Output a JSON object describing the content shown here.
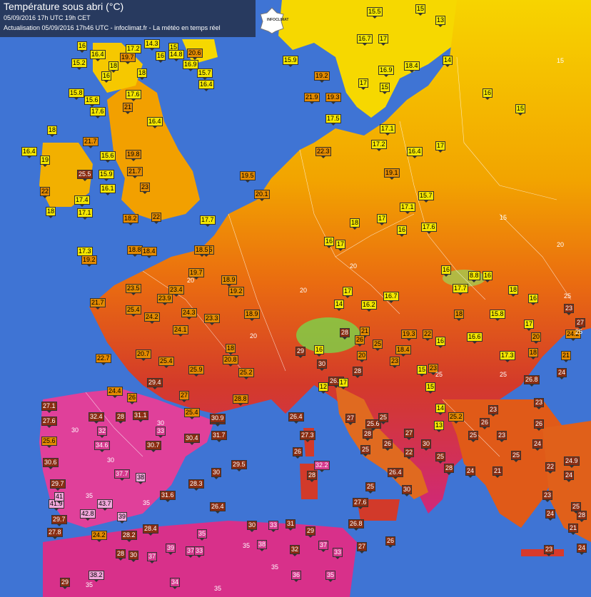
{
  "header": {
    "title": "Température sous abri (°C)",
    "line2": "05/09/2016  17h UTC  19h CET",
    "line3": "Actualisation 05/09/2016 17h46 UTC - infoclimat.fr - La météo en temps réel"
  },
  "logo_text": "INFOCLIMAT",
  "colors": {
    "sea": "#3f74d4",
    "yellow": "#f4e600",
    "orange": "#e38a00",
    "red": "#8a2d12",
    "pink": "#d63a8e",
    "lightpink": "#f2a8dc"
  },
  "stations": [
    {
      "v": "16",
      "c": "y"
    },
    {
      "v": "17.2",
      "c": "y"
    },
    {
      "v": "14.3",
      "c": "y"
    },
    {
      "v": "15",
      "c": "y"
    },
    {
      "v": "16",
      "c": "y"
    },
    {
      "v": "14.8",
      "c": "y"
    },
    {
      "v": "20.6",
      "c": "o"
    },
    {
      "v": "16.4",
      "c": "y"
    },
    {
      "v": "19.7",
      "c": "o"
    },
    {
      "v": "15.2",
      "c": "y"
    },
    {
      "v": "18",
      "c": "y"
    },
    {
      "v": "16.9",
      "c": "y"
    },
    {
      "v": "15.7",
      "c": "y"
    },
    {
      "v": "16",
      "c": "y"
    },
    {
      "v": "18",
      "c": "y"
    },
    {
      "v": "16.4",
      "c": "y"
    },
    {
      "v": "15.8",
      "c": "y"
    },
    {
      "v": "17.6",
      "c": "y"
    },
    {
      "v": "15.6",
      "c": "y"
    },
    {
      "v": "17.6",
      "c": "y"
    },
    {
      "v": "21",
      "c": "o"
    },
    {
      "v": "16.4",
      "c": "y"
    },
    {
      "v": "18",
      "c": "y"
    },
    {
      "v": "21.7",
      "c": "o"
    },
    {
      "v": "16.4",
      "c": "y"
    },
    {
      "v": "19",
      "c": "y"
    },
    {
      "v": "15.6",
      "c": "y"
    },
    {
      "v": "19.8",
      "c": "o"
    },
    {
      "v": "25.5",
      "c": "r"
    },
    {
      "v": "15.9",
      "c": "y"
    },
    {
      "v": "21.7",
      "c": "o"
    },
    {
      "v": "22",
      "c": "o"
    },
    {
      "v": "16.1",
      "c": "y"
    },
    {
      "v": "23",
      "c": "o"
    },
    {
      "v": "17.4",
      "c": "y"
    },
    {
      "v": "18",
      "c": "y"
    },
    {
      "v": "17.1",
      "c": "y"
    },
    {
      "v": "18.2",
      "c": "o"
    },
    {
      "v": "22",
      "c": "o"
    },
    {
      "v": "17.7",
      "c": "y"
    },
    {
      "v": "18.5",
      "c": "o"
    },
    {
      "v": "17.3",
      "c": "y"
    },
    {
      "v": "18.8",
      "c": "o"
    },
    {
      "v": "19.2",
      "c": "o"
    },
    {
      "v": "18.4",
      "c": "o"
    },
    {
      "v": "15.5",
      "c": "y"
    },
    {
      "v": "15",
      "c": "y"
    },
    {
      "v": "13",
      "c": "y"
    },
    {
      "v": "16.7",
      "c": "y"
    },
    {
      "v": "17",
      "c": "y"
    },
    {
      "v": "14",
      "c": "y"
    },
    {
      "v": "15.9",
      "c": "y"
    },
    {
      "v": "18.4",
      "c": "y"
    },
    {
      "v": "16.9",
      "c": "y"
    },
    {
      "v": "17",
      "c": "y"
    },
    {
      "v": "15",
      "c": "y"
    },
    {
      "v": "16",
      "c": "y"
    },
    {
      "v": "15",
      "c": "y"
    },
    {
      "v": "19.2",
      "c": "o"
    },
    {
      "v": "21.9",
      "c": "o"
    },
    {
      "v": "19.3",
      "c": "o"
    },
    {
      "v": "17.5",
      "c": "y"
    },
    {
      "v": "17.1",
      "c": "y"
    },
    {
      "v": "17.2",
      "c": "y"
    },
    {
      "v": "19.1",
      "c": "o"
    },
    {
      "v": "16.4",
      "c": "y"
    },
    {
      "v": "17",
      "c": "y"
    },
    {
      "v": "17.1",
      "c": "y"
    },
    {
      "v": "15.7",
      "c": "y"
    },
    {
      "v": "17.6",
      "c": "y"
    },
    {
      "v": "19.5",
      "c": "o"
    },
    {
      "v": "20.1",
      "c": "o"
    },
    {
      "v": "22.3",
      "c": "o"
    },
    {
      "v": "18.5",
      "c": "o"
    },
    {
      "v": "18.9",
      "c": "o"
    },
    {
      "v": "19.2",
      "c": "o"
    },
    {
      "v": "18.9",
      "c": "o"
    },
    {
      "v": "18",
      "c": "o"
    },
    {
      "v": "19.7",
      "c": "o"
    },
    {
      "v": "21.7",
      "c": "o"
    },
    {
      "v": "23.5",
      "c": "o"
    },
    {
      "v": "25.4",
      "c": "o"
    },
    {
      "v": "23.9",
      "c": "o"
    },
    {
      "v": "23.4",
      "c": "o"
    },
    {
      "v": "24.3",
      "c": "o"
    },
    {
      "v": "24.2",
      "c": "o"
    },
    {
      "v": "23.3",
      "c": "o"
    },
    {
      "v": "24.1",
      "c": "o"
    },
    {
      "v": "22.7",
      "c": "o"
    },
    {
      "v": "20.7",
      "c": "o"
    },
    {
      "v": "25.4",
      "c": "o"
    },
    {
      "v": "29.4",
      "c": "r"
    },
    {
      "v": "25.9",
      "c": "o"
    },
    {
      "v": "20.8",
      "c": "o"
    },
    {
      "v": "25.2",
      "c": "o"
    },
    {
      "v": "24.4",
      "c": "o"
    },
    {
      "v": "26",
      "c": "o"
    },
    {
      "v": "27",
      "c": "o"
    },
    {
      "v": "30.9",
      "c": "r"
    },
    {
      "v": "28.8",
      "c": "o"
    },
    {
      "v": "27.1",
      "c": "r"
    },
    {
      "v": "27.6",
      "c": "r"
    },
    {
      "v": "32.4",
      "c": "r"
    },
    {
      "v": "28",
      "c": "r"
    },
    {
      "v": "31.1",
      "c": "r"
    },
    {
      "v": "25.4",
      "c": "o"
    },
    {
      "v": "30.9",
      "c": "r"
    },
    {
      "v": "25.6",
      "c": "o"
    },
    {
      "v": "34.6",
      "c": "p"
    },
    {
      "v": "32",
      "c": "p"
    },
    {
      "v": "33",
      "c": "p"
    },
    {
      "v": "30.4",
      "c": "r"
    },
    {
      "v": "31.7",
      "c": "r"
    },
    {
      "v": "30.6",
      "c": "r"
    },
    {
      "v": "30.7",
      "c": "r"
    },
    {
      "v": "29.7",
      "c": "r"
    },
    {
      "v": "37.7",
      "c": "p"
    },
    {
      "v": "38",
      "c": "l"
    },
    {
      "v": "41.9",
      "c": "l"
    },
    {
      "v": "41",
      "c": "l"
    },
    {
      "v": "31.6",
      "c": "r"
    },
    {
      "v": "28.3",
      "c": "r"
    },
    {
      "v": "30",
      "c": "r"
    },
    {
      "v": "29.5",
      "c": "r"
    },
    {
      "v": "42.8",
      "c": "l"
    },
    {
      "v": "43.7",
      "c": "l"
    },
    {
      "v": "39",
      "c": "l"
    },
    {
      "v": "26.4",
      "c": "r"
    },
    {
      "v": "29.7",
      "c": "r"
    },
    {
      "v": "27.8",
      "c": "r"
    },
    {
      "v": "24.2",
      "c": "o"
    },
    {
      "v": "28.2",
      "c": "r"
    },
    {
      "v": "28.4",
      "c": "r"
    },
    {
      "v": "35",
      "c": "p"
    },
    {
      "v": "30",
      "c": "r"
    },
    {
      "v": "33",
      "c": "p"
    },
    {
      "v": "31",
      "c": "r"
    },
    {
      "v": "26.8",
      "c": "r"
    },
    {
      "v": "29",
      "c": "r"
    },
    {
      "v": "28",
      "c": "r"
    },
    {
      "v": "30",
      "c": "r"
    },
    {
      "v": "37",
      "c": "p"
    },
    {
      "v": "39",
      "c": "p"
    },
    {
      "v": "37",
      "c": "p"
    },
    {
      "v": "33",
      "c": "p"
    },
    {
      "v": "38",
      "c": "p"
    },
    {
      "v": "32",
      "c": "r"
    },
    {
      "v": "37",
      "c": "p"
    },
    {
      "v": "33",
      "c": "p"
    },
    {
      "v": "27",
      "c": "r"
    },
    {
      "v": "26",
      "c": "r"
    },
    {
      "v": "29",
      "c": "r"
    },
    {
      "v": "38.2",
      "c": "l"
    },
    {
      "v": "34",
      "c": "p"
    },
    {
      "v": "36",
      "c": "p"
    },
    {
      "v": "35",
      "c": "p"
    },
    {
      "v": "26.4",
      "c": "r"
    },
    {
      "v": "27.3",
      "c": "r"
    },
    {
      "v": "26",
      "c": "r"
    },
    {
      "v": "32.2",
      "c": "p"
    },
    {
      "v": "28",
      "c": "r"
    },
    {
      "v": "25",
      "c": "r"
    },
    {
      "v": "27.6",
      "c": "r"
    },
    {
      "v": "30",
      "c": "r"
    },
    {
      "v": "25",
      "c": "r"
    },
    {
      "v": "26.4",
      "c": "r"
    },
    {
      "v": "27",
      "c": "r"
    },
    {
      "v": "26",
      "c": "r"
    },
    {
      "v": "28",
      "c": "r"
    },
    {
      "v": "25.6",
      "c": "r"
    },
    {
      "v": "27",
      "c": "r"
    },
    {
      "v": "25",
      "c": "r"
    },
    {
      "v": "22",
      "c": "r"
    },
    {
      "v": "30",
      "c": "r"
    },
    {
      "v": "25",
      "c": "r"
    },
    {
      "v": "28",
      "c": "r"
    },
    {
      "v": "24",
      "c": "r"
    },
    {
      "v": "21",
      "c": "r"
    },
    {
      "v": "26",
      "c": "r"
    },
    {
      "v": "25",
      "c": "r"
    },
    {
      "v": "23",
      "c": "r"
    },
    {
      "v": "25.2",
      "c": "o"
    },
    {
      "v": "23",
      "c": "r"
    },
    {
      "v": "26.8",
      "c": "r"
    },
    {
      "v": "24",
      "c": "r"
    },
    {
      "v": "23",
      "c": "r"
    },
    {
      "v": "26",
      "c": "r"
    },
    {
      "v": "25",
      "c": "r"
    },
    {
      "v": "24",
      "c": "r"
    },
    {
      "v": "24.9",
      "c": "r"
    },
    {
      "v": "22",
      "c": "r"
    },
    {
      "v": "24",
      "c": "r"
    },
    {
      "v": "23",
      "c": "r"
    },
    {
      "v": "25",
      "c": "r"
    },
    {
      "v": "24",
      "c": "r"
    },
    {
      "v": "28",
      "c": "r"
    },
    {
      "v": "21",
      "c": "r"
    },
    {
      "v": "23",
      "c": "r"
    },
    {
      "v": "24",
      "c": "r"
    },
    {
      "v": "17.3",
      "c": "y"
    },
    {
      "v": "16",
      "c": "y"
    },
    {
      "v": "18",
      "c": "y"
    },
    {
      "v": "17",
      "c": "y"
    },
    {
      "v": "15.8",
      "c": "y"
    },
    {
      "v": "16.6",
      "c": "y"
    },
    {
      "v": "17.7",
      "c": "y"
    },
    {
      "v": "16",
      "c": "y"
    },
    {
      "v": "18",
      "c": "o"
    },
    {
      "v": "19.3",
      "c": "o"
    },
    {
      "v": "22",
      "c": "o"
    },
    {
      "v": "18.4",
      "c": "o"
    },
    {
      "v": "16",
      "c": "y"
    },
    {
      "v": "16.7",
      "c": "y"
    },
    {
      "v": "16.2",
      "c": "y"
    },
    {
      "v": "14",
      "c": "y"
    },
    {
      "v": "17",
      "c": "y"
    },
    {
      "v": "21",
      "c": "o"
    },
    {
      "v": "20",
      "c": "o"
    },
    {
      "v": "23",
      "c": "o"
    },
    {
      "v": "23",
      "c": "o"
    },
    {
      "v": "26",
      "c": "o"
    },
    {
      "v": "25",
      "c": "o"
    },
    {
      "v": "28",
      "c": "r"
    },
    {
      "v": "29",
      "c": "r"
    },
    {
      "v": "30",
      "c": "r"
    },
    {
      "v": "28",
      "c": "r"
    },
    {
      "v": "26.8",
      "c": "r"
    },
    {
      "v": "12",
      "c": "y"
    },
    {
      "v": "17",
      "c": "y"
    },
    {
      "v": "16",
      "c": "y"
    },
    {
      "v": "15",
      "c": "y"
    },
    {
      "v": "15",
      "c": "y"
    },
    {
      "v": "14",
      "c": "y"
    },
    {
      "v": "13",
      "c": "y"
    },
    {
      "v": "8.8",
      "c": "y"
    },
    {
      "v": "16",
      "c": "y"
    },
    {
      "v": "17",
      "c": "y"
    },
    {
      "v": "18",
      "c": "y"
    },
    {
      "v": "16",
      "c": "y"
    },
    {
      "v": "17",
      "c": "y"
    },
    {
      "v": "16",
      "c": "y"
    },
    {
      "v": "23",
      "c": "r"
    },
    {
      "v": "27",
      "c": "r"
    },
    {
      "v": "24.2",
      "c": "o"
    },
    {
      "v": "21",
      "c": "o"
    },
    {
      "v": "20",
      "c": "o"
    },
    {
      "v": "18",
      "c": "o"
    }
  ],
  "isolines": [
    "20",
    "25",
    "30",
    "35",
    "15"
  ]
}
